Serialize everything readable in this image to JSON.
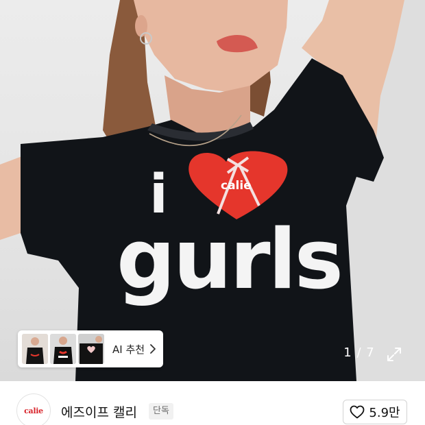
{
  "gallery": {
    "image": "model wearing black t-shirt",
    "print_line1": "i",
    "print_line2": "gurls",
    "print_heart_text": "calie",
    "counter": "1 / 7",
    "expand_icon": "expand-icon"
  },
  "ai_recommend": {
    "label": "AI 추천",
    "thumbnails": [
      "thumbnail-1",
      "thumbnail-2",
      "thumbnail-3"
    ],
    "chevron_icon": "chevron-right-icon"
  },
  "brand": {
    "logo_text": "calie",
    "name": "에즈이프 캘리",
    "badge": "단독"
  },
  "like": {
    "icon": "heart-icon",
    "count": "5.9만"
  },
  "colors": {
    "heart_red": "#e5362c",
    "shirt_black": "#111418",
    "logo_red": "#d8232a"
  }
}
